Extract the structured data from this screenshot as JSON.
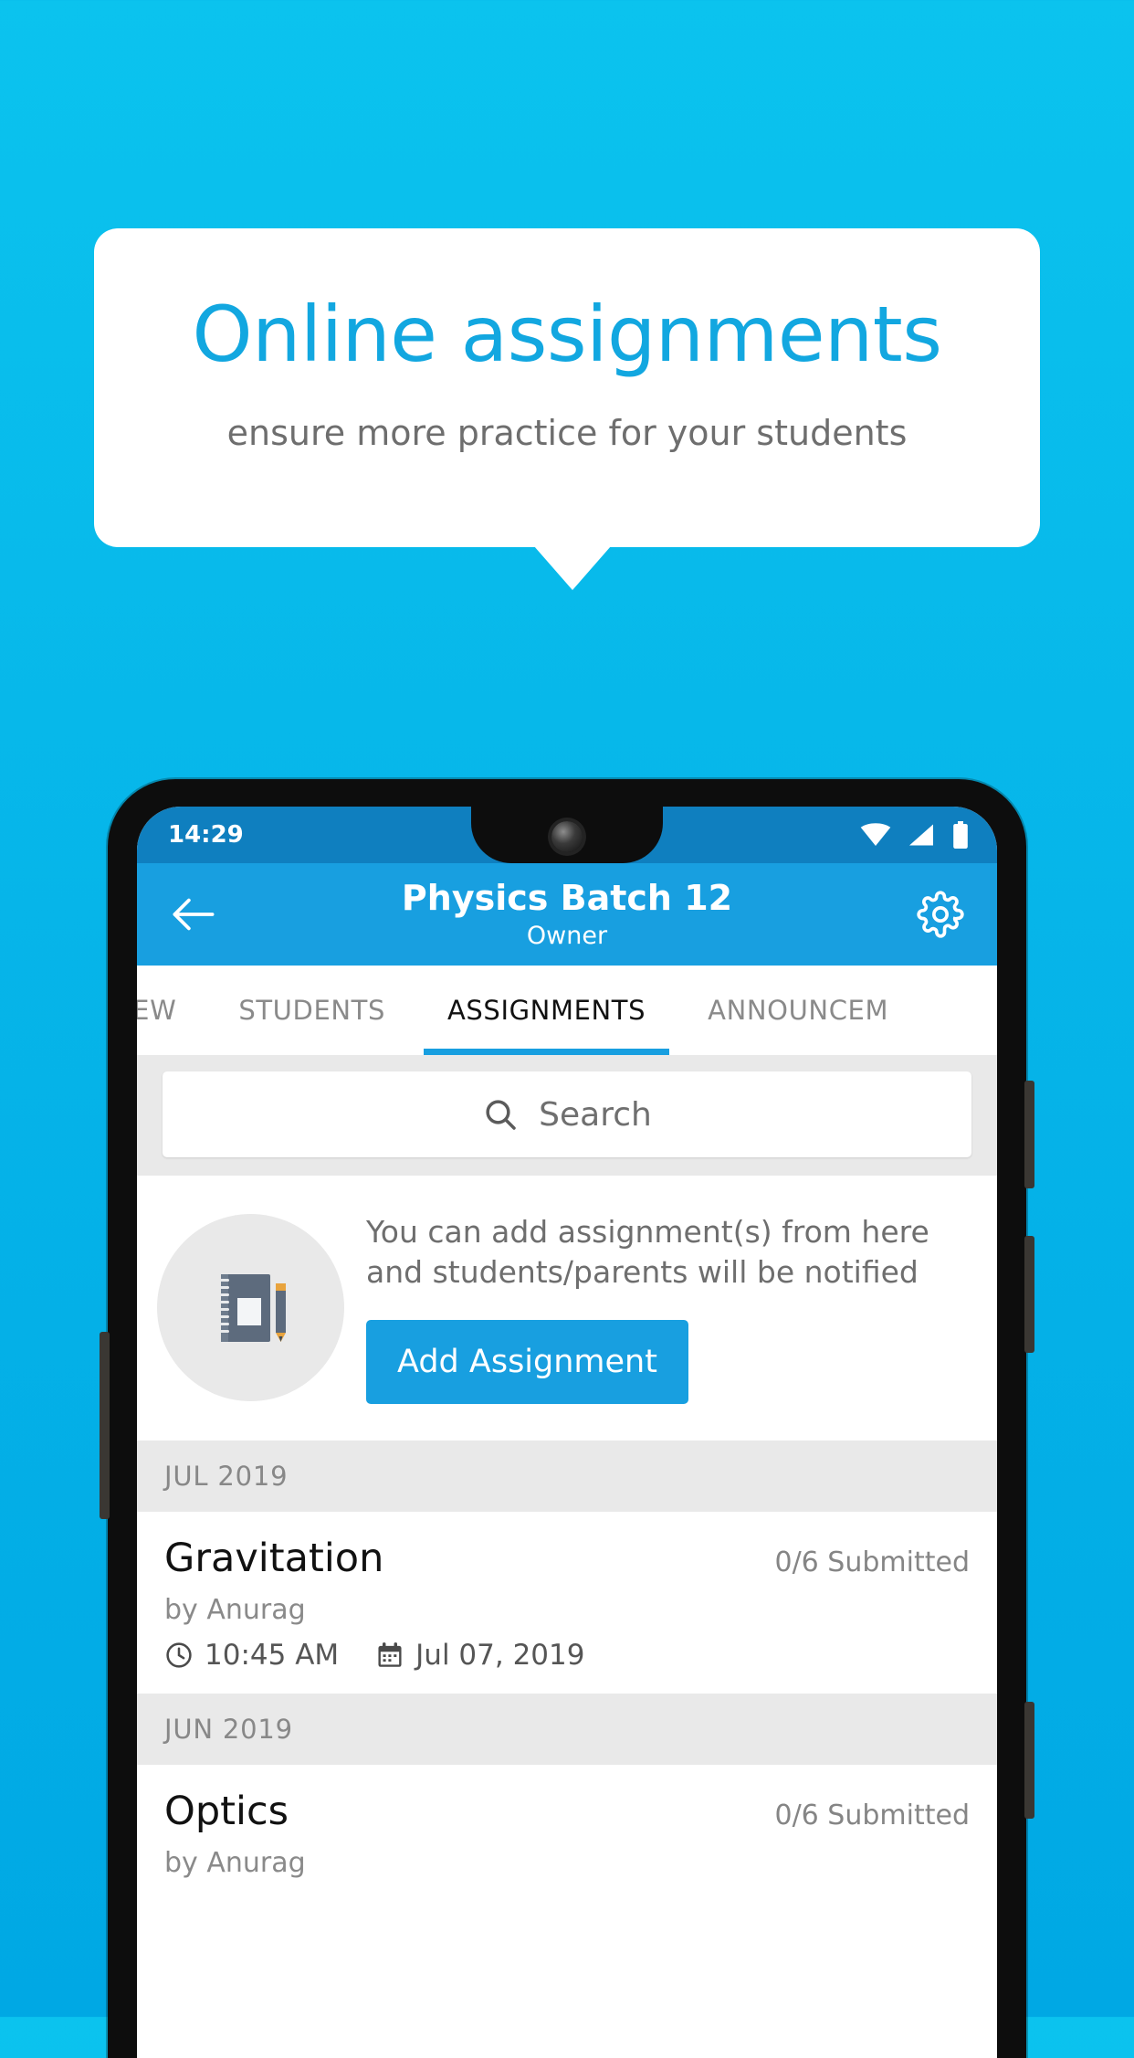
{
  "promo": {
    "title": "Online assignments",
    "subtitle": "ensure more practice for your students"
  },
  "colors": {
    "background_top": "#0BC3EE",
    "background_bottom": "#00A8E4",
    "accent": "#189FE0",
    "statusbar": "#0F7FBF",
    "promo_title": "#12A7E0"
  },
  "phone": {
    "statusbar": {
      "time": "14:29",
      "icons": [
        "wifi-icon",
        "signal-icon",
        "battery-icon"
      ]
    },
    "appbar": {
      "back_icon": "back-arrow-icon",
      "title": "Physics Batch 12",
      "subtitle": "Owner",
      "settings_icon": "gear-icon"
    },
    "tabs": [
      {
        "label": "IEW",
        "active": false,
        "clipped": true
      },
      {
        "label": "STUDENTS",
        "active": false
      },
      {
        "label": "ASSIGNMENTS",
        "active": true
      },
      {
        "label": "ANNOUNCEM",
        "active": false,
        "clipped": true
      }
    ],
    "search": {
      "icon": "search-icon",
      "placeholder": "Search",
      "value": ""
    },
    "empty_state": {
      "illustration": "notebook-pen-icon",
      "message": "You can add assignment(s) from here and students/parents will be notified",
      "button_label": "Add Assignment"
    },
    "groups": [
      {
        "month": "JUL 2019",
        "items": [
          {
            "title": "Gravitation",
            "status": "0/6 Submitted",
            "author": "by Anurag",
            "time": "10:45 AM",
            "date": "Jul 07, 2019",
            "time_icon": "clock-icon",
            "date_icon": "calendar-icon"
          }
        ]
      },
      {
        "month": "JUN 2019",
        "items": [
          {
            "title": "Optics",
            "status": "0/6 Submitted",
            "author": "by Anurag",
            "time": "",
            "date": "",
            "time_icon": "clock-icon",
            "date_icon": "calendar-icon"
          }
        ]
      }
    ]
  }
}
